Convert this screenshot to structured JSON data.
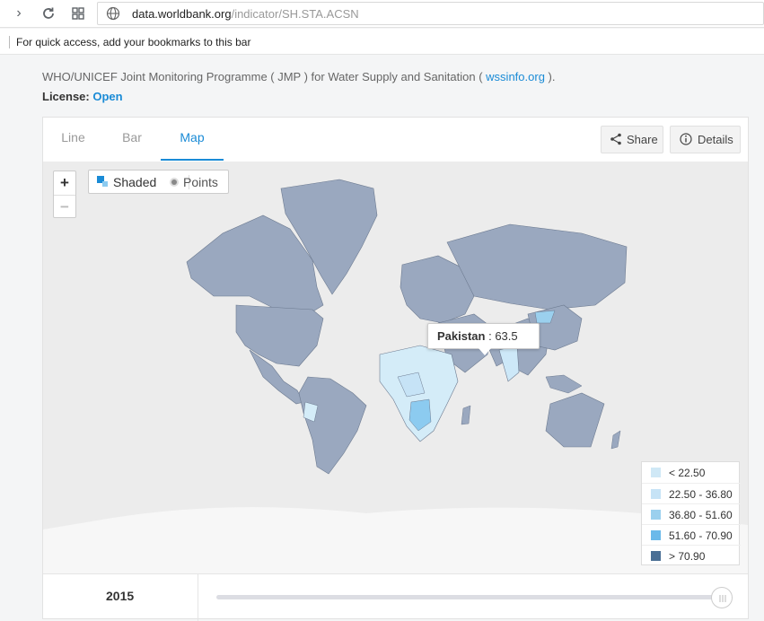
{
  "browser": {
    "url_host": "data.worldbank.org",
    "url_path": "/indicator/SH.STA.ACSN",
    "bookmarks_hint": "For quick access, add your bookmarks to this bar"
  },
  "source": {
    "text": "WHO/UNICEF Joint Monitoring Programme ( JMP ) for Water Supply and Sanitation (",
    "link": "wssinfo.org",
    "suffix": ")."
  },
  "license": {
    "label": "License:",
    "value": "Open"
  },
  "tabs": [
    {
      "label": "Line",
      "active": false
    },
    {
      "label": "Bar",
      "active": false
    },
    {
      "label": "Map",
      "active": true
    }
  ],
  "actions": {
    "share": "Share",
    "details": "Details"
  },
  "map_controls": {
    "zoom_in": "+",
    "zoom_out": "−",
    "shaded": "Shaded",
    "points": "Points"
  },
  "tooltip": {
    "country": "Pakistan",
    "value": "63.5"
  },
  "legend": [
    {
      "label": "< 22.50",
      "color": "#cfe8f6"
    },
    {
      "label": "22.50 - 36.80",
      "color": "#c6e3f6"
    },
    {
      "label": "36.80 - 51.60",
      "color": "#9bd0ee"
    },
    {
      "label": "51.60 - 70.90",
      "color": "#6bb9ea"
    },
    {
      "label": "> 70.90",
      "color": "#4a6f94"
    }
  ],
  "timeline": {
    "year": "2015"
  },
  "colors": {
    "accent": "#1a8bd6",
    "land": "#9aa8bf",
    "water": "#ececec",
    "low": "#cde8f8",
    "mid": "#8ccbf0",
    "high": "#5eaee6"
  }
}
